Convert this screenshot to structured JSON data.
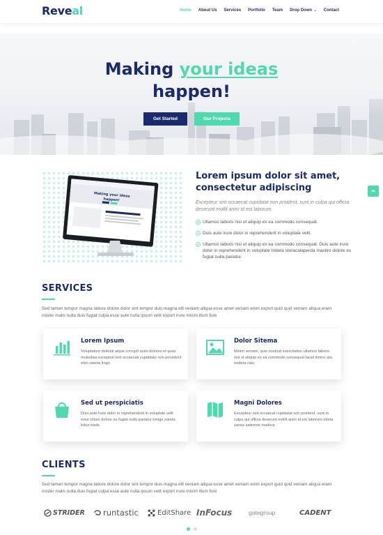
{
  "header": {
    "logo_main": "Reve",
    "logo_accent": "al",
    "nav": [
      "Home",
      "About Us",
      "Services",
      "Portfolio",
      "Team",
      "Drop Down",
      "Contact"
    ]
  },
  "hero": {
    "title_pre": "Making ",
    "title_highlight": "your ideas",
    "title_line2": "happen!",
    "btn_start": "Get Started",
    "btn_projects": "Our Projects"
  },
  "about": {
    "title": "Lorem ipsum dolor sit amet, consectetur adipiscing",
    "lead": "Excepteur sint occaecat cupidatat non proident, sunt in culpa qui officia deserunt mollit anim id est laborum.",
    "items": [
      "Ullamco laboris nisi ut aliquip ex ea commodo consequat.",
      "Duis aute irure dolor in reprehenderit in voluptate velit.",
      "Ullamco laboris nisi ut aliquip ex ea commodo consequat. Duis aute irure dolor in reprehenderit in voluptate trideta storacalaperda mastiro dolore eu fugiat nulla pariatur."
    ],
    "screen_text": "Making your ideas happen!"
  },
  "services": {
    "title": "SERVICES",
    "desc": "Sed tamen tempor magna labore dolore dolor sint tempor duis magna elit veniam aliqua esse amet veniam enim export quid quid veniam aliqua eram noster malis nulla duis fugiat culpa esse aute nulla ipsum velit export irure minim illum fore",
    "items": [
      {
        "title": "Lorem Ipsum",
        "icon": "bar-chart-icon",
        "body": "Voluptatum deleniti atque corrupti quos dolores et quas molestias excepturi sint occaecati cupiditate non provident etiro rabeta lingo."
      },
      {
        "title": "Dolor Sitema",
        "icon": "picture-icon",
        "body": "Minim veniam, quis nostrud exercitation ullamco laboris nisi ut aliquip ex ea commodo consequat tarad limino ata nodera clas."
      },
      {
        "title": "Sed ut perspiciatis",
        "icon": "shopping-bag-icon",
        "body": "Duis aute irure dolor in reprehenderit in voluptate velit esse cillum dolore eu fugiat nulla pariatur trinige zareta lobur trade."
      },
      {
        "title": "Magni Dolores",
        "icon": "map-icon",
        "body": "Excepteur sint occaecat cupidatat non proident, sunt in culpa qui officia deserunt mollit anim id est laborum rideta zanox satirente madera"
      }
    ]
  },
  "clients": {
    "title": "CLIENTS",
    "desc": "Sed tamen tempor magna labore dolore dolor sint tempor duis magna elit veniam aliqua esse amet veniam enim export quid quid veniam aliqua eram noster malis nulla duis fugiat culpa esse aute nulla ipsum velit export irure minim illum fore",
    "logos": [
      "STRIDER",
      "runtastic",
      "EditShare",
      "InFocus",
      "gategroup",
      "CADENT"
    ]
  },
  "colors": {
    "navy": "#1a2a6c",
    "accent": "#50d8af"
  }
}
